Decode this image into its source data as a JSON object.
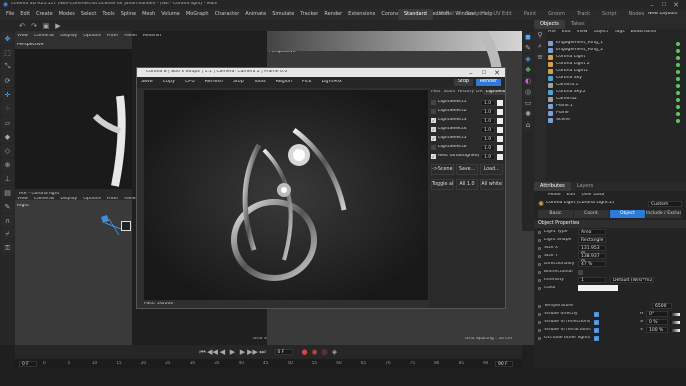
{
  "app": {
    "title": "Cinema 4D R25.117 (Non-Commercial License for Juvan Randel) - [iWi - Corona light] - Main",
    "menus": [
      "File",
      "Edit",
      "Create",
      "Modes",
      "Select",
      "Tools",
      "Spline",
      "Mesh",
      "Volume",
      "MoGraph",
      "Character",
      "Animate",
      "Simulate",
      "Tracker",
      "Render",
      "Extensions",
      "Corona",
      "Octane",
      "Redshift",
      "Window",
      "Help"
    ],
    "layout_tabs": [
      "Standard",
      "Model",
      "Sculpt",
      "UV Edit",
      "Paint",
      "Groom",
      "Track",
      "Script",
      "Nodes"
    ],
    "active_layout": "Standard",
    "new_layouts": "New Layouts"
  },
  "viewport_top": {
    "menu": [
      "View",
      "Cameras",
      "Display",
      "Options",
      "Filter",
      "Panel",
      "Redshift"
    ],
    "label": "Perspective"
  },
  "viewport_top_right": {
    "menu": [
      "View",
      "Cameras",
      "Display",
      "Options",
      "Filter",
      "Panel",
      "Redshift"
    ],
    "label": "Perspective"
  },
  "viewport_bottom": {
    "tab": "IRR - Corona light",
    "menu": [
      "View",
      "Cameras",
      "Display",
      "Options",
      "Filter",
      "Panel",
      "Redshift"
    ],
    "label": "Right",
    "grid_spacing": "Grid Spacing : 100 cm"
  },
  "viewport_bottom_right": {
    "grid_spacing": "Grid Spacing : 50 cm"
  },
  "render_window": {
    "title": "Corona 8 | 800 x 600px | 1:1 | Camera: Camera 2 | Frame 0.0",
    "toolbar": [
      "Save",
      "Copy",
      "CPU",
      "Refresh",
      "Stop",
      "Tools",
      "Region",
      "Pick",
      "LightMix"
    ],
    "toolbar_right": [
      "Stop",
      "Render"
    ],
    "panel_tabs": [
      "Post",
      "Stats",
      "History",
      "DR",
      "LightMix"
    ],
    "light_selects": [
      {
        "name": "LightSelect1",
        "value": "1.0",
        "checked": false
      },
      {
        "name": "LightSelect2",
        "value": "1.0",
        "checked": false
      },
      {
        "name": "LightSelect3",
        "value": "1.0",
        "checked": true
      },
      {
        "name": "LightSelect4",
        "value": "1.0",
        "checked": true
      },
      {
        "name": "LightSelect5",
        "value": "1.0",
        "checked": true
      },
      {
        "name": "LightSelect6",
        "value": "1.0",
        "checked": false
      },
      {
        "name": "Rest (unassigned)",
        "value": "1.0",
        "checked": true
      }
    ],
    "buttons_row1": [
      "->Scene",
      "Save...",
      "Load..."
    ],
    "buttons_row2": [
      "Toggle all",
      "All 1.0",
      "All white"
    ],
    "status": "Pass: 26/200"
  },
  "object_manager": {
    "tabs": [
      "Objects",
      "Takes"
    ],
    "menu": [
      "File",
      "Edit",
      "View",
      "Object",
      "Tags",
      "Bookmarks"
    ],
    "items": [
      {
        "name": "Engagement_Ring_1",
        "color": "#7a9fd0"
      },
      {
        "name": "Engagement_Ring_2",
        "color": "#7a9fd0"
      },
      {
        "name": "Corona Light",
        "color": "#d0a050"
      },
      {
        "name": "Corona Light 2",
        "color": "#d0a050"
      },
      {
        "name": "Corona Light1",
        "color": "#d0a050"
      },
      {
        "name": "Corona Sky",
        "color": "#50a0d0"
      },
      {
        "name": "Camera.1",
        "color": "#a0a0a0"
      },
      {
        "name": "Corona Sky.2",
        "color": "#50a0d0"
      },
      {
        "name": "Camera2",
        "color": "#a0a0a0"
      },
      {
        "name": "Plane.1",
        "color": "#7a9fd0"
      },
      {
        "name": "Plane",
        "color": "#7a9fd0"
      },
      {
        "name": "Scene",
        "color": "#7a9fd0"
      }
    ]
  },
  "attributes": {
    "tabs": [
      "Attributes",
      "Layers"
    ],
    "menu": [
      "Mode",
      "Edit",
      "User Data"
    ],
    "object_title": "Corona Light [Corona Light.2]",
    "preset": "Custom",
    "section_tabs": [
      "Basic",
      "Coord.",
      "Object",
      "Include / Exclude"
    ],
    "active_section": "Object",
    "section_header": "Object Properties",
    "props": [
      {
        "label": "Light Type",
        "value": "Area"
      },
      {
        "label": "Light Shape",
        "value": "Rectangle"
      },
      {
        "label": "Size X",
        "value": "131.953 m"
      },
      {
        "label": "Size Y",
        "value": "138.937 m"
      },
      {
        "label": "Directionality",
        "value": "47 %"
      },
      {
        "label": "Bidirectional",
        "value": ""
      },
      {
        "label": "Intensity",
        "value": "1"
      },
      {
        "label": "Color",
        "value": ""
      }
    ],
    "intensity_unit": "Default (W/sr*m2)",
    "color_values": [
      {
        "label": "H",
        "value": "0°"
      },
      {
        "label": "S",
        "value": "0 %"
      },
      {
        "label": "V",
        "value": "100 %"
      }
    ],
    "temperature": "6500",
    "bottom_rows": [
      {
        "label": "Temperature",
        "value": ""
      },
      {
        "label": "Visible directly",
        "value": ""
      },
      {
        "label": "Visible in reflections",
        "value": ""
      },
      {
        "label": "Visible in refractions",
        "value": ""
      },
      {
        "label": "Occlude other lights",
        "value": ""
      }
    ]
  },
  "timeline": {
    "frame_start": "0 F",
    "frame_current": "0 F",
    "frame_end": "90 F",
    "ruler": [
      "0",
      "5",
      "10",
      "15",
      "20",
      "25",
      "30",
      "35",
      "40",
      "45",
      "50",
      "55",
      "60",
      "65",
      "70",
      "75",
      "80",
      "85",
      "90"
    ]
  }
}
